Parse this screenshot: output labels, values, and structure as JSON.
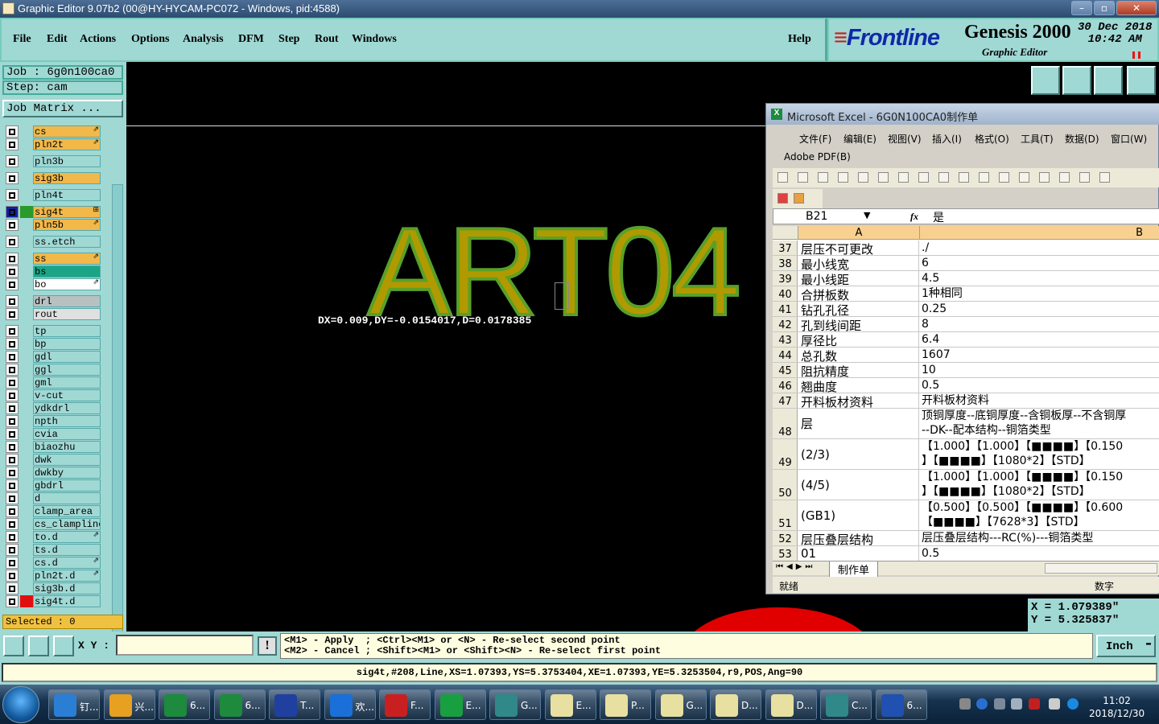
{
  "window": {
    "title": "Graphic Editor 9.07b2 (00@HY-HYCAM-PC072 - Windows, pid:4588)"
  },
  "menubar": {
    "items": [
      "File",
      "Edit",
      "Actions",
      "Options",
      "Analysis",
      "DFM",
      "Step",
      "Rout",
      "Windows"
    ],
    "help": "Help"
  },
  "logo": {
    "brand": "Frontline",
    "product": "Genesis 2000",
    "subtitle": "Graphic Editor",
    "date": "30 Dec 2018",
    "time": "10:42 AM"
  },
  "job": {
    "job": "Job : 6g0n100ca0",
    "step": "Step: cam",
    "matrix": "Job Matrix ..."
  },
  "layers": [
    {
      "name": "cs",
      "color": "#f2b84a",
      "mark": "⇗"
    },
    {
      "name": "pln2t",
      "color": "#f2b84a",
      "mark": "⇗"
    },
    {
      "name": "pln3b",
      "color": "#a0d8d4",
      "mark": ""
    },
    {
      "name": "sig3b",
      "color": "#f2b84a",
      "mark": ""
    },
    {
      "name": "pln4t",
      "color": "#a0d8d4",
      "mark": ""
    },
    {
      "name": "sig4t",
      "color": "#f2b84a",
      "mark": "⊞"
    },
    {
      "name": "pln5b",
      "color": "#f2b84a",
      "mark": "⇗"
    },
    {
      "name": "ss.etch",
      "color": "#a0d8d4",
      "mark": ""
    },
    {
      "name": "ss",
      "color": "#f2b84a",
      "mark": "⇗"
    },
    {
      "name": "bs",
      "color": "#1aa686",
      "mark": ""
    },
    {
      "name": "bo",
      "color": "#ffffff",
      "mark": "⇗"
    },
    {
      "name": "drl",
      "color": "#b8c0c0",
      "mark": ""
    },
    {
      "name": "rout",
      "color": "#e0e0e0",
      "mark": ""
    },
    {
      "name": "tp",
      "color": "#a0d8d4",
      "mark": ""
    },
    {
      "name": "bp",
      "color": "#a0d8d4",
      "mark": ""
    },
    {
      "name": "gdl",
      "color": "#a0d8d4",
      "mark": ""
    },
    {
      "name": "ggl",
      "color": "#a0d8d4",
      "mark": ""
    },
    {
      "name": "gml",
      "color": "#a0d8d4",
      "mark": ""
    },
    {
      "name": "v-cut",
      "color": "#a0d8d4",
      "mark": ""
    },
    {
      "name": "ydkdrl",
      "color": "#a0d8d4",
      "mark": ""
    },
    {
      "name": "npth",
      "color": "#a0d8d4",
      "mark": ""
    },
    {
      "name": "cvia",
      "color": "#a0d8d4",
      "mark": ""
    },
    {
      "name": "biaozhu",
      "color": "#a0d8d4",
      "mark": ""
    },
    {
      "name": "dwk",
      "color": "#a0d8d4",
      "mark": ""
    },
    {
      "name": "dwkby",
      "color": "#a0d8d4",
      "mark": ""
    },
    {
      "name": "gbdrl",
      "color": "#a0d8d4",
      "mark": ""
    },
    {
      "name": "d",
      "color": "#a0d8d4",
      "mark": ""
    },
    {
      "name": "clamp_area",
      "color": "#a0d8d4",
      "mark": ""
    },
    {
      "name": "cs_clampline",
      "color": "#a0d8d4",
      "mark": ""
    },
    {
      "name": "to.d",
      "color": "#a0d8d4",
      "mark": "⇗"
    },
    {
      "name": "ts.d",
      "color": "#a0d8d4",
      "mark": ""
    },
    {
      "name": "cs.d",
      "color": "#a0d8d4",
      "mark": "⇗"
    },
    {
      "name": "pln2t.d",
      "color": "#a0d8d4",
      "mark": "⇗"
    },
    {
      "name": "sig3b.d",
      "color": "#a0d8d4",
      "mark": ""
    },
    {
      "name": "sig4t.d",
      "color": "#a0d8d4",
      "mark": ""
    }
  ],
  "selected": "Selected : 0",
  "canvas": {
    "art_text": "ART04",
    "measure": "DX=0.009,DY=-0.0154017,D=0.0178385"
  },
  "excel": {
    "title": "Microsoft Excel - 6G0N100CA0制作单",
    "menu": [
      "文件(F)",
      "编辑(E)",
      "视图(V)",
      "插入(I)",
      "格式(O)",
      "工具(T)",
      "数据(D)",
      "窗口(W)"
    ],
    "menu2": "Adobe PDF(B)",
    "namebox": "B21",
    "fx": "fx",
    "formula": "是",
    "col_a": "A",
    "col_b": "B",
    "rows": [
      {
        "n": "37",
        "a": "层压不可更改",
        "b": "./"
      },
      {
        "n": "38",
        "a": "最小线宽",
        "b": "6"
      },
      {
        "n": "39",
        "a": "最小线距",
        "b": "4.5"
      },
      {
        "n": "40",
        "a": "合拼板数",
        "b": "1种相同"
      },
      {
        "n": "41",
        "a": "钻孔孔径",
        "b": "0.25"
      },
      {
        "n": "42",
        "a": "孔到线间距",
        "b": "8"
      },
      {
        "n": "43",
        "a": "厚径比",
        "b": "6.4"
      },
      {
        "n": "44",
        "a": "总孔数",
        "b": "1607"
      },
      {
        "n": "45",
        "a": "阻抗精度",
        "b": "10"
      },
      {
        "n": "46",
        "a": "翘曲度",
        "b": "0.5"
      },
      {
        "n": "47",
        "a": "开料板材资料",
        "b": "开料板材资料"
      },
      {
        "n": "48",
        "a": "层",
        "b": "顶铜厚度--底铜厚度--含铜板厚--不含铜厚\n--DK--配本结构--铜箔类型"
      },
      {
        "n": "49",
        "a": "(2/3)",
        "b": "【1.000】【1.000】【■■■■】【0.150\n】【■■■■】【1080*2】【STD】"
      },
      {
        "n": "50",
        "a": "(4/5)",
        "b": "【1.000】【1.000】【■■■■】【0.150\n】【■■■■】【1080*2】【STD】"
      },
      {
        "n": "51",
        "a": "(GB1)",
        "b": "【0.500】【0.500】【■■■■】【0.600\n【■■■■】【7628*3】【STD】"
      },
      {
        "n": "52",
        "a": "层压叠层结构",
        "b": "层压叠层结构---RC(%)---铜箔类型"
      },
      {
        "n": "53",
        "a": "01",
        "b": "0.5"
      }
    ],
    "sheet_tab": "制作单",
    "status_left": "就绪",
    "status_right": "数字"
  },
  "coords": {
    "x": "X = 1.079389\"",
    "y": "Y = 5.325837\""
  },
  "cmd": {
    "xy_label": "X Y :",
    "xy_value": "",
    "excl": "!",
    "hint1": "<M1> - Apply  ; <Ctrl><M1> or <N> - Re-select second point",
    "hint2": "<M2> - Cancel ; <Shift><M1> or <Shift><N> - Re-select first point",
    "unit": "Inch"
  },
  "info": "sig4t,#208,Line,XS=1.07393,YS=5.3753404,XE=1.07393,YE=5.3253504,r9,POS,Ang=90",
  "taskbar": {
    "items": [
      {
        "label": "钉...",
        "color": "#2a7fd4"
      },
      {
        "label": "兴...",
        "color": "#e8a020"
      },
      {
        "label": "6...",
        "color": "#1d8a3d"
      },
      {
        "label": "6...",
        "color": "#1d8a3d"
      },
      {
        "label": "T...",
        "color": "#2040a0"
      },
      {
        "label": "欢...",
        "color": "#1a70d8"
      },
      {
        "label": "F...",
        "color": "#c82020"
      },
      {
        "label": "E...",
        "color": "#18a040"
      },
      {
        "label": "G...",
        "color": "#308888"
      },
      {
        "label": "E...",
        "color": "#e8e0a0"
      },
      {
        "label": "P...",
        "color": "#e8e0a0"
      },
      {
        "label": "G...",
        "color": "#e8e0a0"
      },
      {
        "label": "D...",
        "color": "#e8e0a0"
      },
      {
        "label": "D...",
        "color": "#e8e0a0"
      },
      {
        "label": "C...",
        "color": "#308888"
      },
      {
        "label": "6...",
        "color": "#2050b0"
      }
    ],
    "time": "11:02",
    "date": "2018/12/30"
  }
}
